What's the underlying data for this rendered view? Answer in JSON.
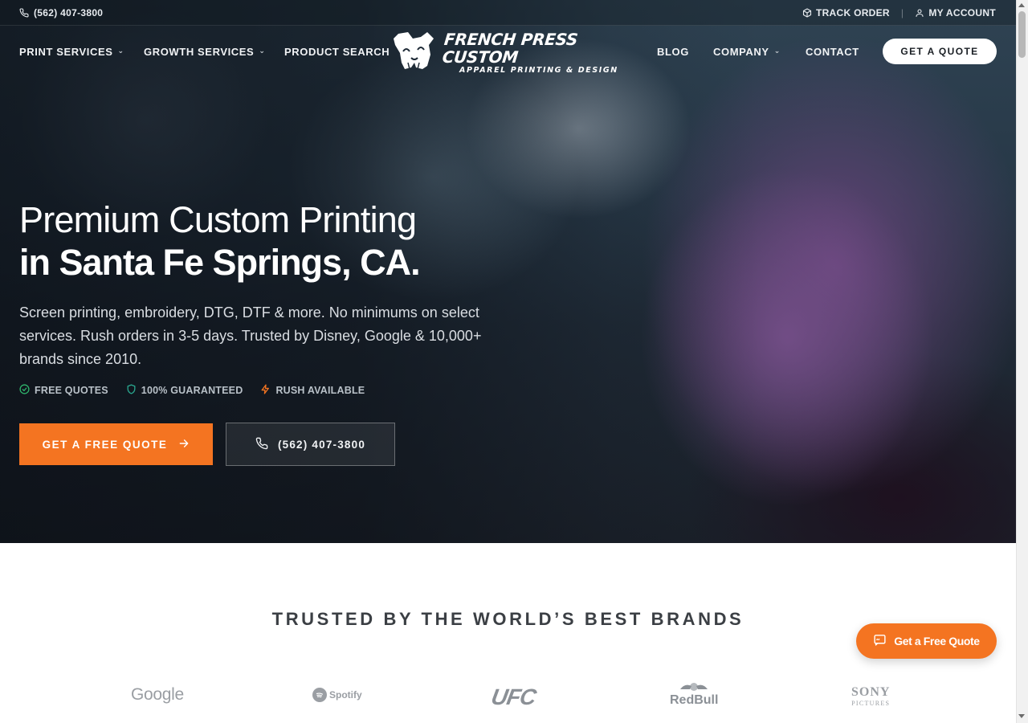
{
  "topbar": {
    "phone": "(562) 407-3800",
    "track_order": "TRACK ORDER",
    "separator": "|",
    "my_account": "MY ACCOUNT"
  },
  "nav": {
    "print_services": "PRINT SERVICES",
    "growth_services": "GROWTH SERVICES",
    "product_search": "PRODUCT SEARCH",
    "logo_line1": "FRENCH PRESS CUSTOM",
    "logo_line2": "APPAREL PRINTING & DESIGN",
    "blog": "BLOG",
    "company": "COMPANY",
    "contact": "CONTACT",
    "quote_button": "GET A QUOTE"
  },
  "hero": {
    "headline_line1": "Premium Custom Printing",
    "headline_line2": "in Santa Fe Springs, CA.",
    "subtext": "Screen printing, embroidery, DTG, DTF & more. No minimums on select services. Rush orders in 3-5 days. Trusted by Disney, Google & 10,000+ brands since 2010.",
    "badges": [
      "FREE QUOTES",
      "100% GUARANTEED",
      "RUSH AVAILABLE"
    ],
    "cta_primary": "GET A FREE QUOTE",
    "cta_secondary": "(562) 407-3800"
  },
  "trusted": {
    "title": "TRUSTED BY THE WORLD’S BEST BRANDS",
    "brands": [
      "Google",
      "Spotify",
      "UFC",
      "RedBull",
      "SONY",
      "PICTURES"
    ]
  },
  "floating": {
    "label": "Get a Free Quote"
  },
  "colors": {
    "accent": "#f47421",
    "badge_green": "#2fb36b",
    "badge_teal": "#2aa78f",
    "badge_orange": "#f47421"
  },
  "icons": {
    "phone": "phone-icon",
    "track": "box-icon",
    "account": "user-icon",
    "arrow": "arrow-right-icon",
    "chat": "chat-icon"
  }
}
